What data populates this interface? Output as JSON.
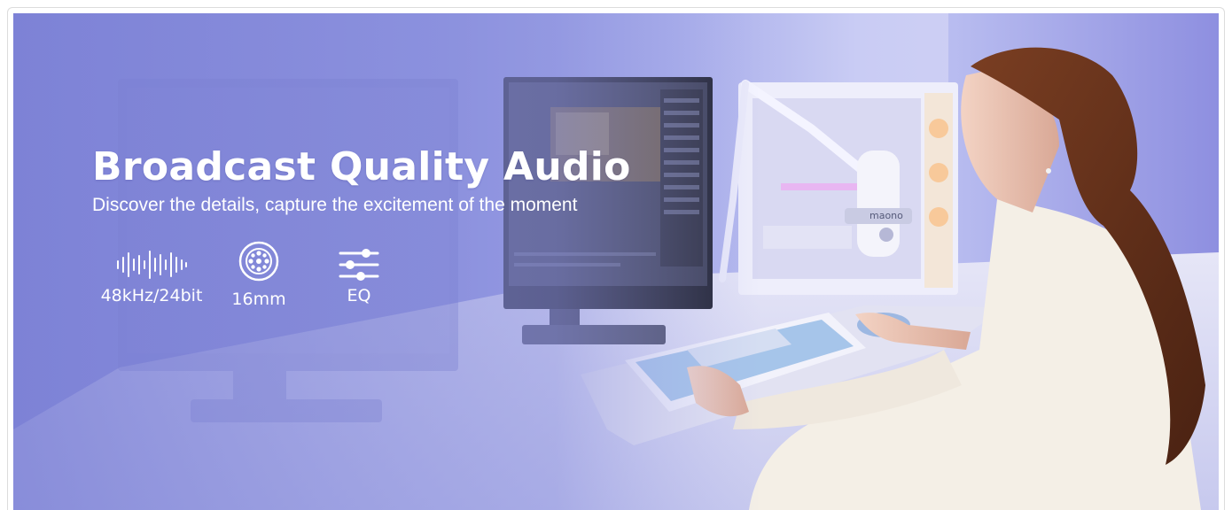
{
  "banner": {
    "headline": "Broadcast Quality Audio",
    "subheadline": "Discover the details, capture the excitement of the moment",
    "mic_brand_mark": "maono",
    "features": [
      {
        "icon": "sound-wave-icon",
        "label": "48kHz/24bit"
      },
      {
        "icon": "capsule-icon",
        "label": "16mm"
      },
      {
        "icon": "eq-sliders-icon",
        "label": "EQ"
      }
    ],
    "colors": {
      "overlay_start": "#7d82d6",
      "overlay_end": "#d8d6f3",
      "text": "#ffffff"
    }
  }
}
